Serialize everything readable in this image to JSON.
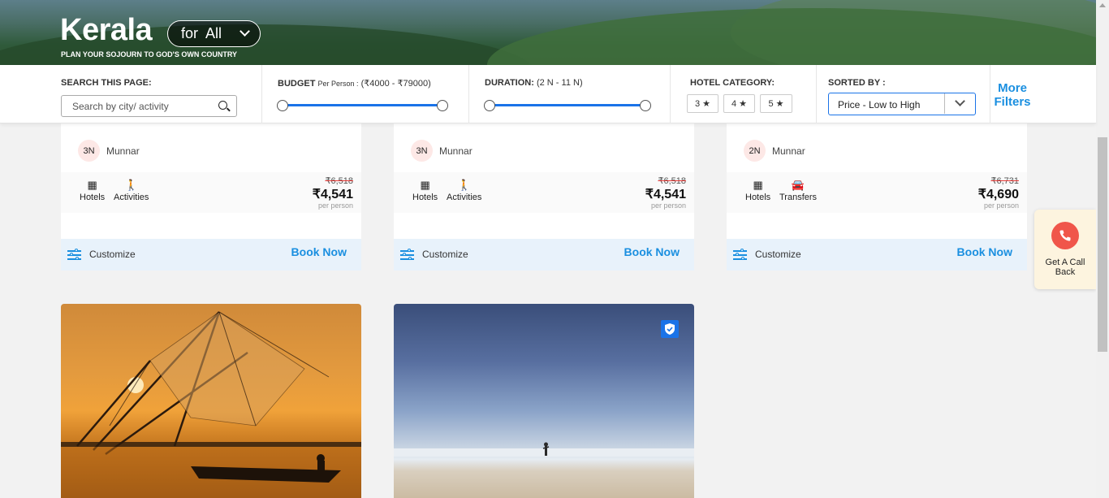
{
  "hero": {
    "title": "Kerala",
    "subtitle": "PLAN YOUR SOJOURN TO GOD'S OWN COUNTRY",
    "for_label": "for",
    "for_value": "All"
  },
  "filters": {
    "search": {
      "label": "SEARCH THIS PAGE:",
      "placeholder": "Search by city/ activity",
      "icon": "search-icon"
    },
    "budget": {
      "label": "BUDGET",
      "sub": "Per Person :",
      "range": "(₹4000 - ₹79000)",
      "min": 4000,
      "max": 79000
    },
    "duration": {
      "label": "DURATION:",
      "range": "(2 N - 11 N)",
      "min_nights": 2,
      "max_nights": 11
    },
    "hotel_category": {
      "label": "HOTEL CATEGORY:",
      "options": [
        "3 ★",
        "4 ★",
        "5 ★"
      ]
    },
    "sorted_by": {
      "label": "SORTED BY :",
      "value": "Price - Low to High"
    },
    "more_filters": "More Filters",
    "accent_color": "#1a73e8"
  },
  "packages": [
    {
      "nights": "3N",
      "destination": "Munnar",
      "inclusions": [
        {
          "label": "Hotels",
          "icon": "hotel-icon"
        },
        {
          "label": "Activities",
          "icon": "hiker-icon"
        }
      ],
      "old_price": "₹6,518",
      "price": "₹4,541",
      "per": "per person",
      "customize": "Customize",
      "book": "Book Now"
    },
    {
      "nights": "3N",
      "destination": "Munnar",
      "inclusions": [
        {
          "label": "Hotels",
          "icon": "hotel-icon"
        },
        {
          "label": "Activities",
          "icon": "hiker-icon"
        }
      ],
      "old_price": "₹6,518",
      "price": "₹4,541",
      "per": "per person",
      "customize": "Customize",
      "book": "Book Now"
    },
    {
      "nights": "2N",
      "destination": "Munnar",
      "inclusions": [
        {
          "label": "Hotels",
          "icon": "hotel-icon"
        },
        {
          "label": "Transfers",
          "icon": "car-icon"
        }
      ],
      "old_price": "₹6,731",
      "price": "₹4,690",
      "per": "per person",
      "customize": "Customize",
      "book": "Book Now"
    }
  ],
  "callback": {
    "label": "Get A Call Back",
    "icon": "phone-icon",
    "color": "#f0564a"
  }
}
